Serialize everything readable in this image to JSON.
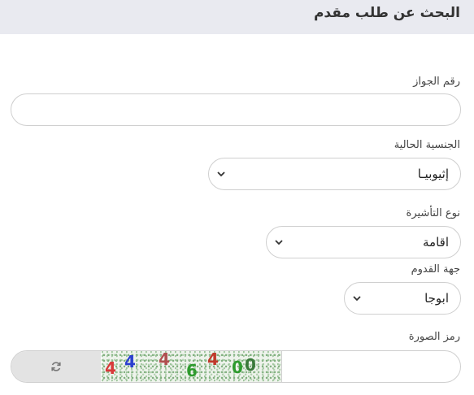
{
  "header": {
    "title": "البحث عن طلب مقدم"
  },
  "passport": {
    "label": "رقم الجواز",
    "value": ""
  },
  "nationality": {
    "label": "الجنسية الحالية",
    "selected": "إثيوبيـا"
  },
  "visa_type": {
    "label": "نوع التأشيرة",
    "selected": "اقامة"
  },
  "arrival_place": {
    "label": "جهة القدوم",
    "selected": "ابوجا"
  },
  "captcha": {
    "label": "رمز الصورة",
    "input_value": "",
    "digits": [
      "4",
      "4",
      "4",
      "6",
      "4",
      "0",
      "0"
    ],
    "digit_colors": [
      "#d83a3a",
      "#2b3fcf",
      "#b05050",
      "#2e9b2e",
      "#c0392b",
      "#2e9b2e",
      "#3a7a3a"
    ]
  },
  "icons": {
    "chevron": "chevron-down-icon",
    "refresh": "refresh-icon"
  }
}
